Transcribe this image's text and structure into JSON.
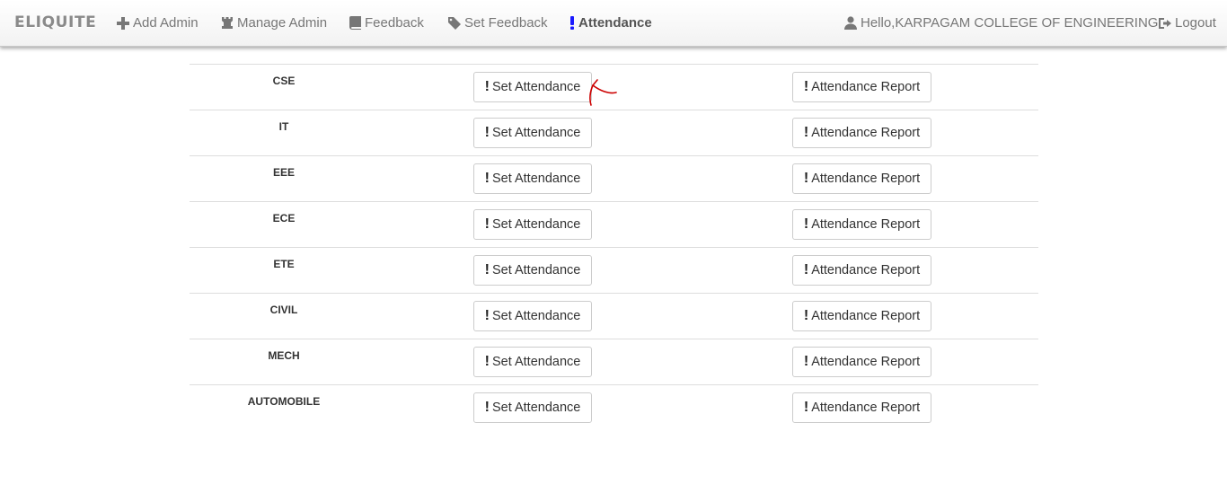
{
  "nav": {
    "brand": "ELIQUITE",
    "items": [
      {
        "label": "Add Admin",
        "icon": "plus-icon"
      },
      {
        "label": "Manage Admin",
        "icon": "rook-icon"
      },
      {
        "label": "Feedback",
        "icon": "book-icon"
      },
      {
        "label": "Set Feedback",
        "icon": "tag-icon"
      },
      {
        "label": "Attendance",
        "icon": "exclamation-icon",
        "active": true
      }
    ],
    "user": "Hello,KARPAGAM COLLEGE OF ENGINEERING",
    "logout": "Logout"
  },
  "table": {
    "rows": [
      {
        "dept": "CSE",
        "set": "Set Attendance",
        "report": "Attendance Report"
      },
      {
        "dept": "IT",
        "set": "Set Attendance",
        "report": "Attendance Report"
      },
      {
        "dept": "EEE",
        "set": "Set Attendance",
        "report": "Attendance Report"
      },
      {
        "dept": "ECE",
        "set": "Set Attendance",
        "report": "Attendance Report"
      },
      {
        "dept": "ETE",
        "set": "Set Attendance",
        "report": "Attendance Report"
      },
      {
        "dept": "CIVIL",
        "set": "Set Attendance",
        "report": "Attendance Report"
      },
      {
        "dept": "MECH",
        "set": "Set Attendance",
        "report": "Attendance Report"
      },
      {
        "dept": "AUTOMOBILE",
        "set": "Set Attendance",
        "report": "Attendance Report"
      }
    ]
  },
  "colors": {
    "active_icon": "#1a1aff",
    "annotation": "#cc0000"
  }
}
